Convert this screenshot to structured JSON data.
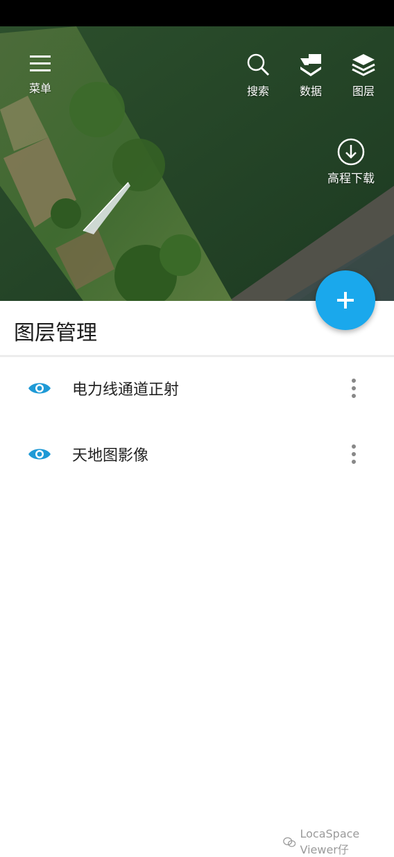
{
  "toolbar": {
    "menu_label": "菜单",
    "search_label": "搜索",
    "data_label": "数据",
    "layers_label": "图层",
    "elevation_download_label": "高程下载"
  },
  "panel": {
    "title": "图层管理",
    "layers": [
      {
        "name": "电力线通道正射",
        "visible": true
      },
      {
        "name": "天地图影像",
        "visible": true
      }
    ]
  },
  "colors": {
    "accent": "#1aa8ec",
    "eye_icon": "#1f9ad6"
  },
  "watermark": "LocaSpace Viewer仔"
}
